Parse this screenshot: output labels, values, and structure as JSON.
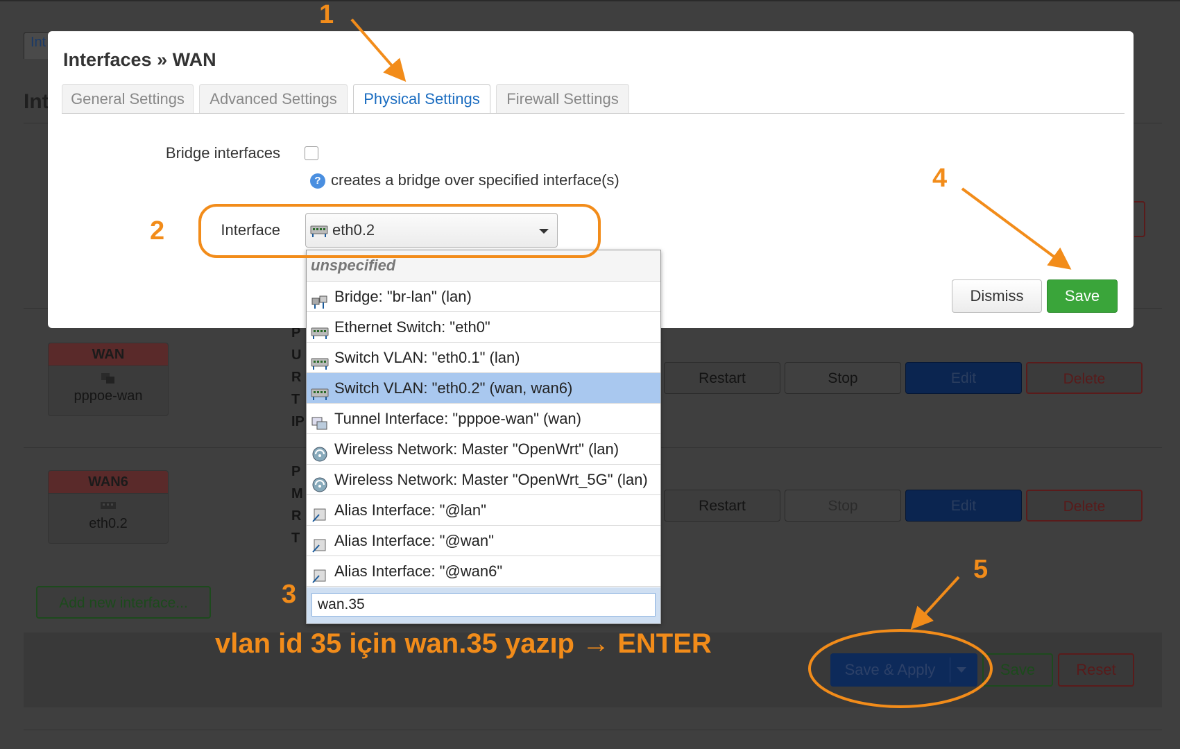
{
  "background": {
    "tab_fragment": "Int",
    "heading_fragment": "Int",
    "interfaces": [
      {
        "name": "WAN",
        "device": "pppoe-wan",
        "row_letters": [
          "P",
          "U",
          "R",
          "T",
          "IP"
        ],
        "stop_disabled": false
      },
      {
        "name": "WAN6",
        "device": "eth0.2",
        "row_letters": [
          "P",
          "M",
          "R",
          "T"
        ],
        "stop_disabled": true
      }
    ],
    "actions": {
      "restart": "Restart",
      "stop": "Stop",
      "edit": "Edit",
      "delete": "Delete"
    },
    "add_interface": "Add new interface...",
    "footer": {
      "save_apply": "Save & Apply",
      "save": "Save",
      "reset": "Reset"
    }
  },
  "modal": {
    "title": "Interfaces » WAN",
    "tabs": [
      {
        "label": "General Settings",
        "active": false
      },
      {
        "label": "Advanced Settings",
        "active": false
      },
      {
        "label": "Physical Settings",
        "active": true
      },
      {
        "label": "Firewall Settings",
        "active": false
      }
    ],
    "bridge_label": "Bridge interfaces",
    "bridge_checked": false,
    "bridge_help": "creates a bridge over specified interface(s)",
    "interface_label": "Interface",
    "interface_value": "eth0.2",
    "interface_icon": "switch-icon",
    "dismiss": "Dismiss",
    "save": "Save"
  },
  "dropdown": {
    "items": [
      {
        "label": "unspecified",
        "icon": "none"
      },
      {
        "label": "Bridge: \"br-lan\" (lan)",
        "icon": "bridge-icon"
      },
      {
        "label": "Ethernet Switch: \"eth0\"",
        "icon": "switch-icon"
      },
      {
        "label": "Switch VLAN: \"eth0.1\" (lan)",
        "icon": "switch-icon"
      },
      {
        "label": "Switch VLAN: \"eth0.2\" (wan, wan6)",
        "icon": "switch-icon",
        "selected": true
      },
      {
        "label": "Tunnel Interface: \"pppoe-wan\" (wan)",
        "icon": "tunnel-icon"
      },
      {
        "label": "Wireless Network: Master \"OpenWrt\" (lan)",
        "icon": "wifi-icon"
      },
      {
        "label": "Wireless Network: Master \"OpenWrt_5G\" (lan)",
        "icon": "wifi-icon"
      },
      {
        "label": "Alias Interface: \"@lan\"",
        "icon": "alias-icon"
      },
      {
        "label": "Alias Interface: \"@wan\"",
        "icon": "alias-icon"
      },
      {
        "label": "Alias Interface: \"@wan6\"",
        "icon": "alias-icon"
      }
    ],
    "custom_input_value": "wan.35"
  },
  "annotations": {
    "steps": [
      "1",
      "2",
      "3",
      "4",
      "5"
    ],
    "instruction": "vlan id 35 için wan.35 yazıp → ENTER",
    "color": "#f28c1a"
  }
}
